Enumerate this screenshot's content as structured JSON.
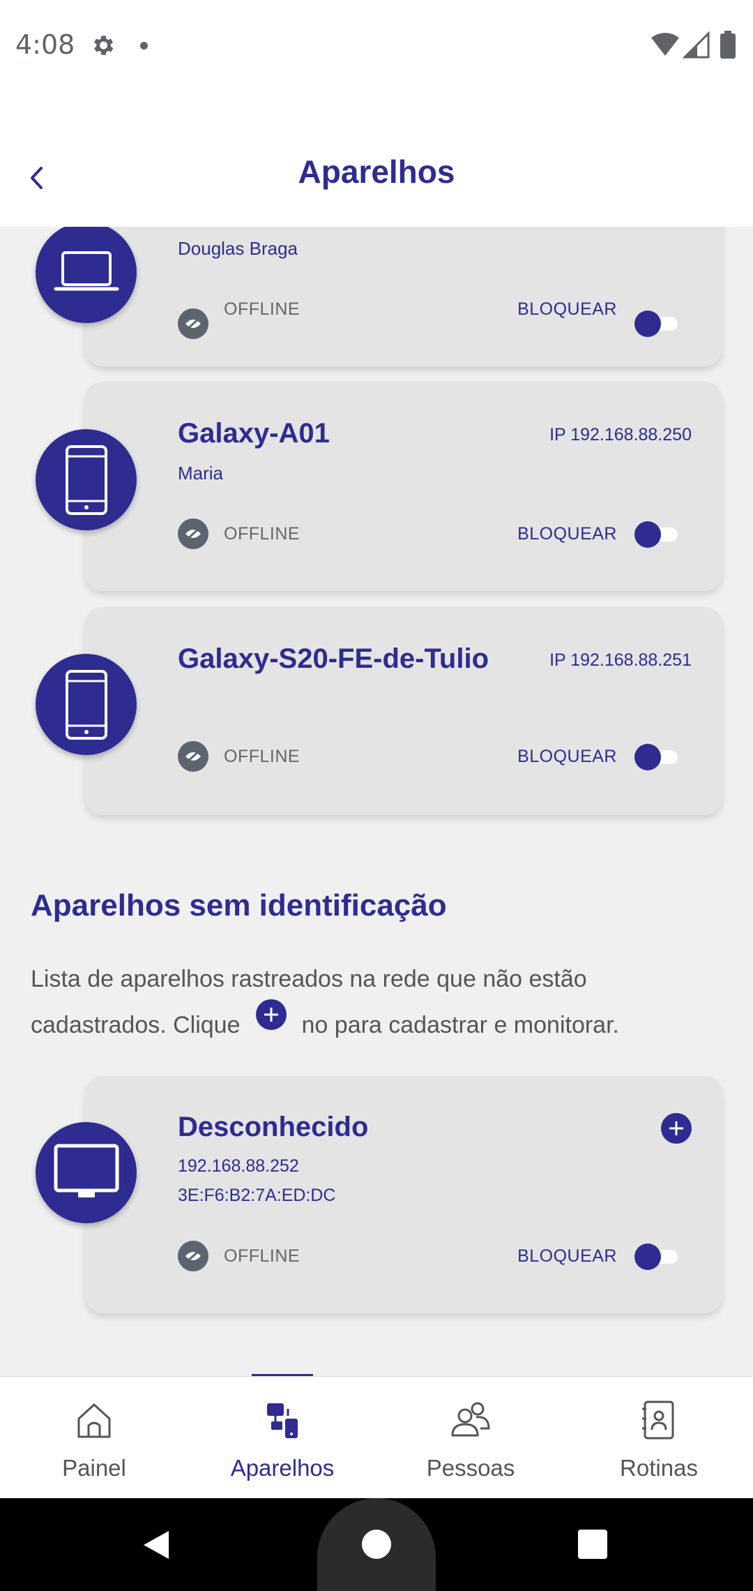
{
  "status_bar": {
    "time": "4:08"
  },
  "header": {
    "title": "Aparelhos"
  },
  "devices": [
    {
      "name": "",
      "owner": "Douglas Braga",
      "ip": "",
      "status": "OFFLINE",
      "block_label": "BLOQUEAR",
      "type": "laptop-icon"
    },
    {
      "name": "Galaxy-A01",
      "owner": "Maria",
      "ip": "IP 192.168.88.250",
      "status": "OFFLINE",
      "block_label": "BLOQUEAR",
      "type": "phone-icon"
    },
    {
      "name": "Galaxy-S20-FE-de-Tulio",
      "owner": "",
      "ip": "IP 192.168.88.251",
      "status": "OFFLINE",
      "block_label": "BLOQUEAR",
      "type": "phone-icon"
    }
  ],
  "unidentified": {
    "title": "Aparelhos sem identificação",
    "desc_before": "Lista de aparelhos rastreados na rede que não estão cadastrados. Clique",
    "desc_after": "no para cadastrar e monitorar.",
    "device": {
      "name": "Desconhecido",
      "ip": "192.168.88.252",
      "mac": "3E:F6:B2:7A:ED:DC",
      "status": "OFFLINE",
      "block_label": "BLOQUEAR",
      "type": "monitor-icon"
    }
  },
  "bottom_nav": {
    "items": [
      {
        "label": "Painel",
        "icon": "home-icon"
      },
      {
        "label": "Aparelhos",
        "icon": "devices-icon",
        "active": true
      },
      {
        "label": "Pessoas",
        "icon": "people-icon"
      },
      {
        "label": "Rotinas",
        "icon": "routines-icon"
      }
    ]
  },
  "colors": {
    "accent": "#2e2c91",
    "card": "#e4e4e4",
    "background": "#f0f0f0"
  }
}
